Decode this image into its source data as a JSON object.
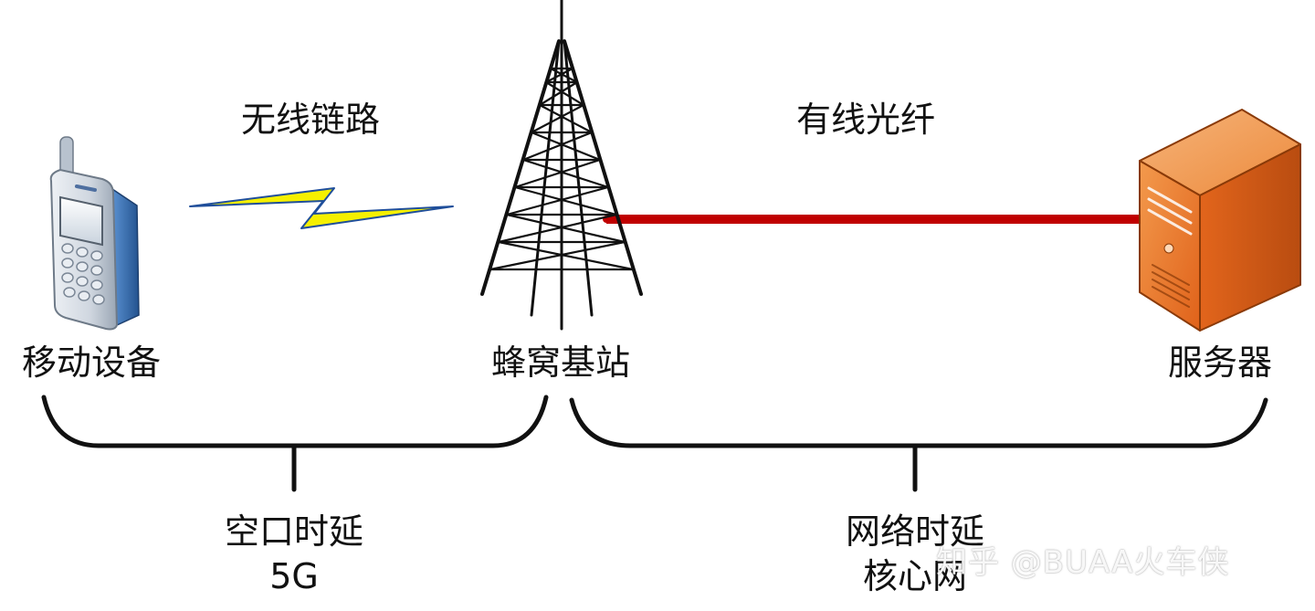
{
  "labels": {
    "wireless_link": "无线链路",
    "wired_fiber": "有线光纤",
    "mobile_device": "移动设备",
    "cell_tower": "蜂窝基站",
    "server": "服务器",
    "air_latency": "空口时延",
    "air_tech": "5G",
    "network_latency": "网络时延",
    "core_network": "核心网"
  },
  "watermark": "知乎 @BUAA火车侠",
  "colors": {
    "fiber": "#c00000",
    "lightning": "#f5f000",
    "lightning_edge": "#1f4e9a",
    "server": "#e8701f",
    "phone_accent": "#3a78c7"
  },
  "icons": [
    "mobile-phone-icon",
    "lightning-bolt-icon",
    "cell-tower-icon",
    "server-icon"
  ]
}
